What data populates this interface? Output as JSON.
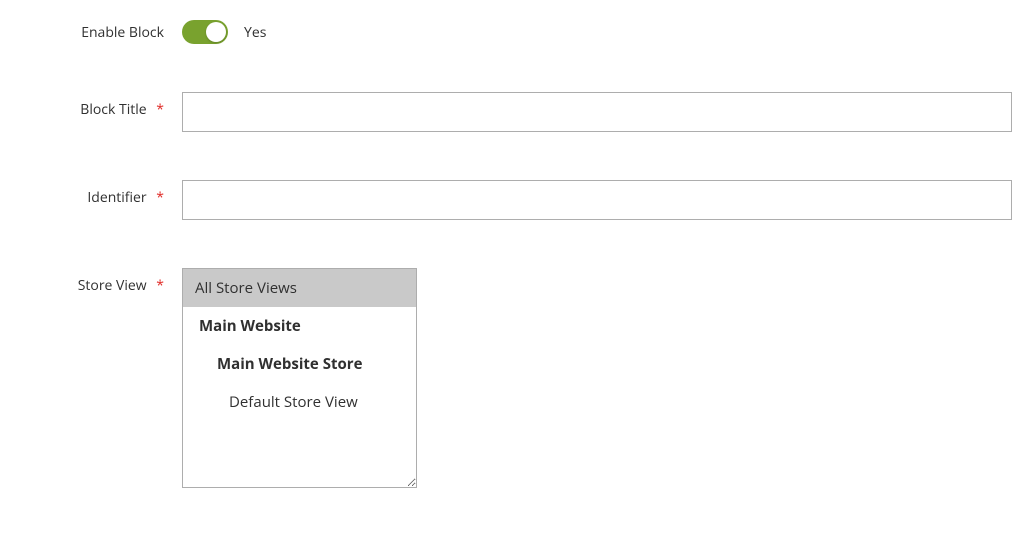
{
  "fields": {
    "enable_block": {
      "label": "Enable Block",
      "value_label": "Yes",
      "enabled": true
    },
    "block_title": {
      "label": "Block Title",
      "required": true,
      "value": ""
    },
    "identifier": {
      "label": "Identifier",
      "required": true,
      "value": ""
    },
    "store_view": {
      "label": "Store View",
      "required": true,
      "options": [
        {
          "label": "All Store Views",
          "level": 0,
          "selected": true
        },
        {
          "label": "Main Website",
          "level": 1,
          "selected": false
        },
        {
          "label": "Main Website Store",
          "level": 2,
          "selected": false
        },
        {
          "label": "Default Store View",
          "level": 3,
          "selected": false
        }
      ]
    }
  },
  "required_marker": "*"
}
